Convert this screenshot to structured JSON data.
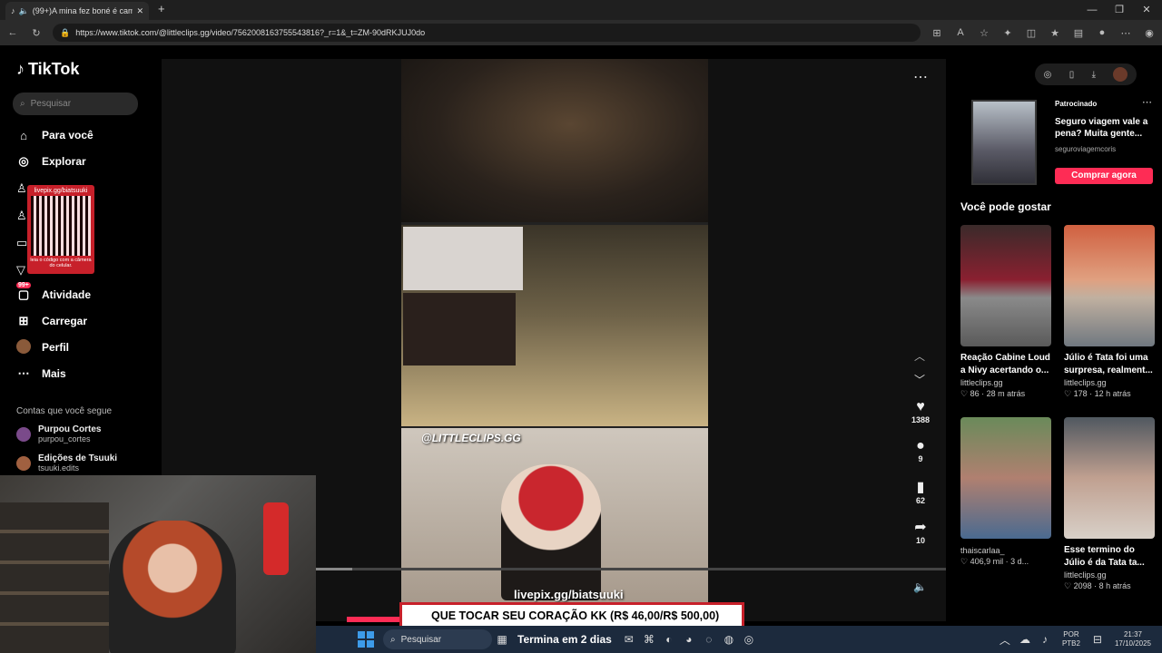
{
  "browser": {
    "tab_title": "(99+)A mina fez boné é cam",
    "url": "https://www.tiktok.com/@littleclips.gg/video/7562008163755543816?_r=1&_t=ZM-90dRKJUJ0do"
  },
  "tiktok": {
    "logo": "TikTok",
    "search_placeholder": "Pesquisar",
    "nav": [
      {
        "label": "Para você",
        "icon": "home-icon"
      },
      {
        "label": "Explorar",
        "icon": "compass-icon"
      },
      {
        "label": "Atividade",
        "icon": "inbox-icon",
        "badge": "99+"
      },
      {
        "label": "Carregar",
        "icon": "plus-square-icon"
      },
      {
        "label": "Perfil",
        "icon": "avatar"
      },
      {
        "label": "Mais",
        "icon": "more-icon"
      }
    ],
    "following_header": "Contas que você segue",
    "following": [
      {
        "name": "Purpou Cortes",
        "handle": "purpou_cortes"
      },
      {
        "name": "Edições de Tsuuki",
        "handle": "tsuuki.edits"
      }
    ]
  },
  "overlay": {
    "qr_url": "livepix.gg/biatsuuki",
    "qr_note": "leia o código com a câmera do celular.",
    "donation_text": "QUE TOCAR SEU CORAÇÃO KK (R$ 46,00/R$ 500,00)",
    "donation_prefix": "0"
  },
  "video": {
    "watermark": "@LITTLECLIPS.GG",
    "livepix": "livepix.gg/biatsuuki",
    "likes": "1388",
    "comments": "9",
    "saves": "62",
    "shares": "10"
  },
  "ad": {
    "sponsored": "Patrocinado",
    "title": "Seguro viagem vale a pena? Muita gente...",
    "account": "seguroviagemcoris",
    "button": "Comprar agora"
  },
  "recommend": {
    "header": "Você pode gostar",
    "cards": [
      {
        "title": "Reação Cabine Loud a Nivy acertando o...",
        "author": "littleclips.gg",
        "likes": "86",
        "time": "28 m atrás"
      },
      {
        "title": "Júlio é Tata foi uma surpresa, realment...",
        "author": "littleclips.gg",
        "likes": "178",
        "time": "12 h atrás"
      },
      {
        "title": "",
        "author": "thaiscarlaa_",
        "likes": "406,9 mil",
        "time": "3 d..."
      },
      {
        "title": "Esse termino do Júlio é da Tata ta...",
        "author": "littleclips.gg",
        "likes": "2098",
        "time": "8 h atrás"
      }
    ]
  },
  "taskbar": {
    "search": "Pesquisar",
    "marquee": "Termina em 2 dias",
    "lang1": "POR",
    "lang2": "PTB2",
    "time": "21:37",
    "date": "17/10/2025"
  }
}
